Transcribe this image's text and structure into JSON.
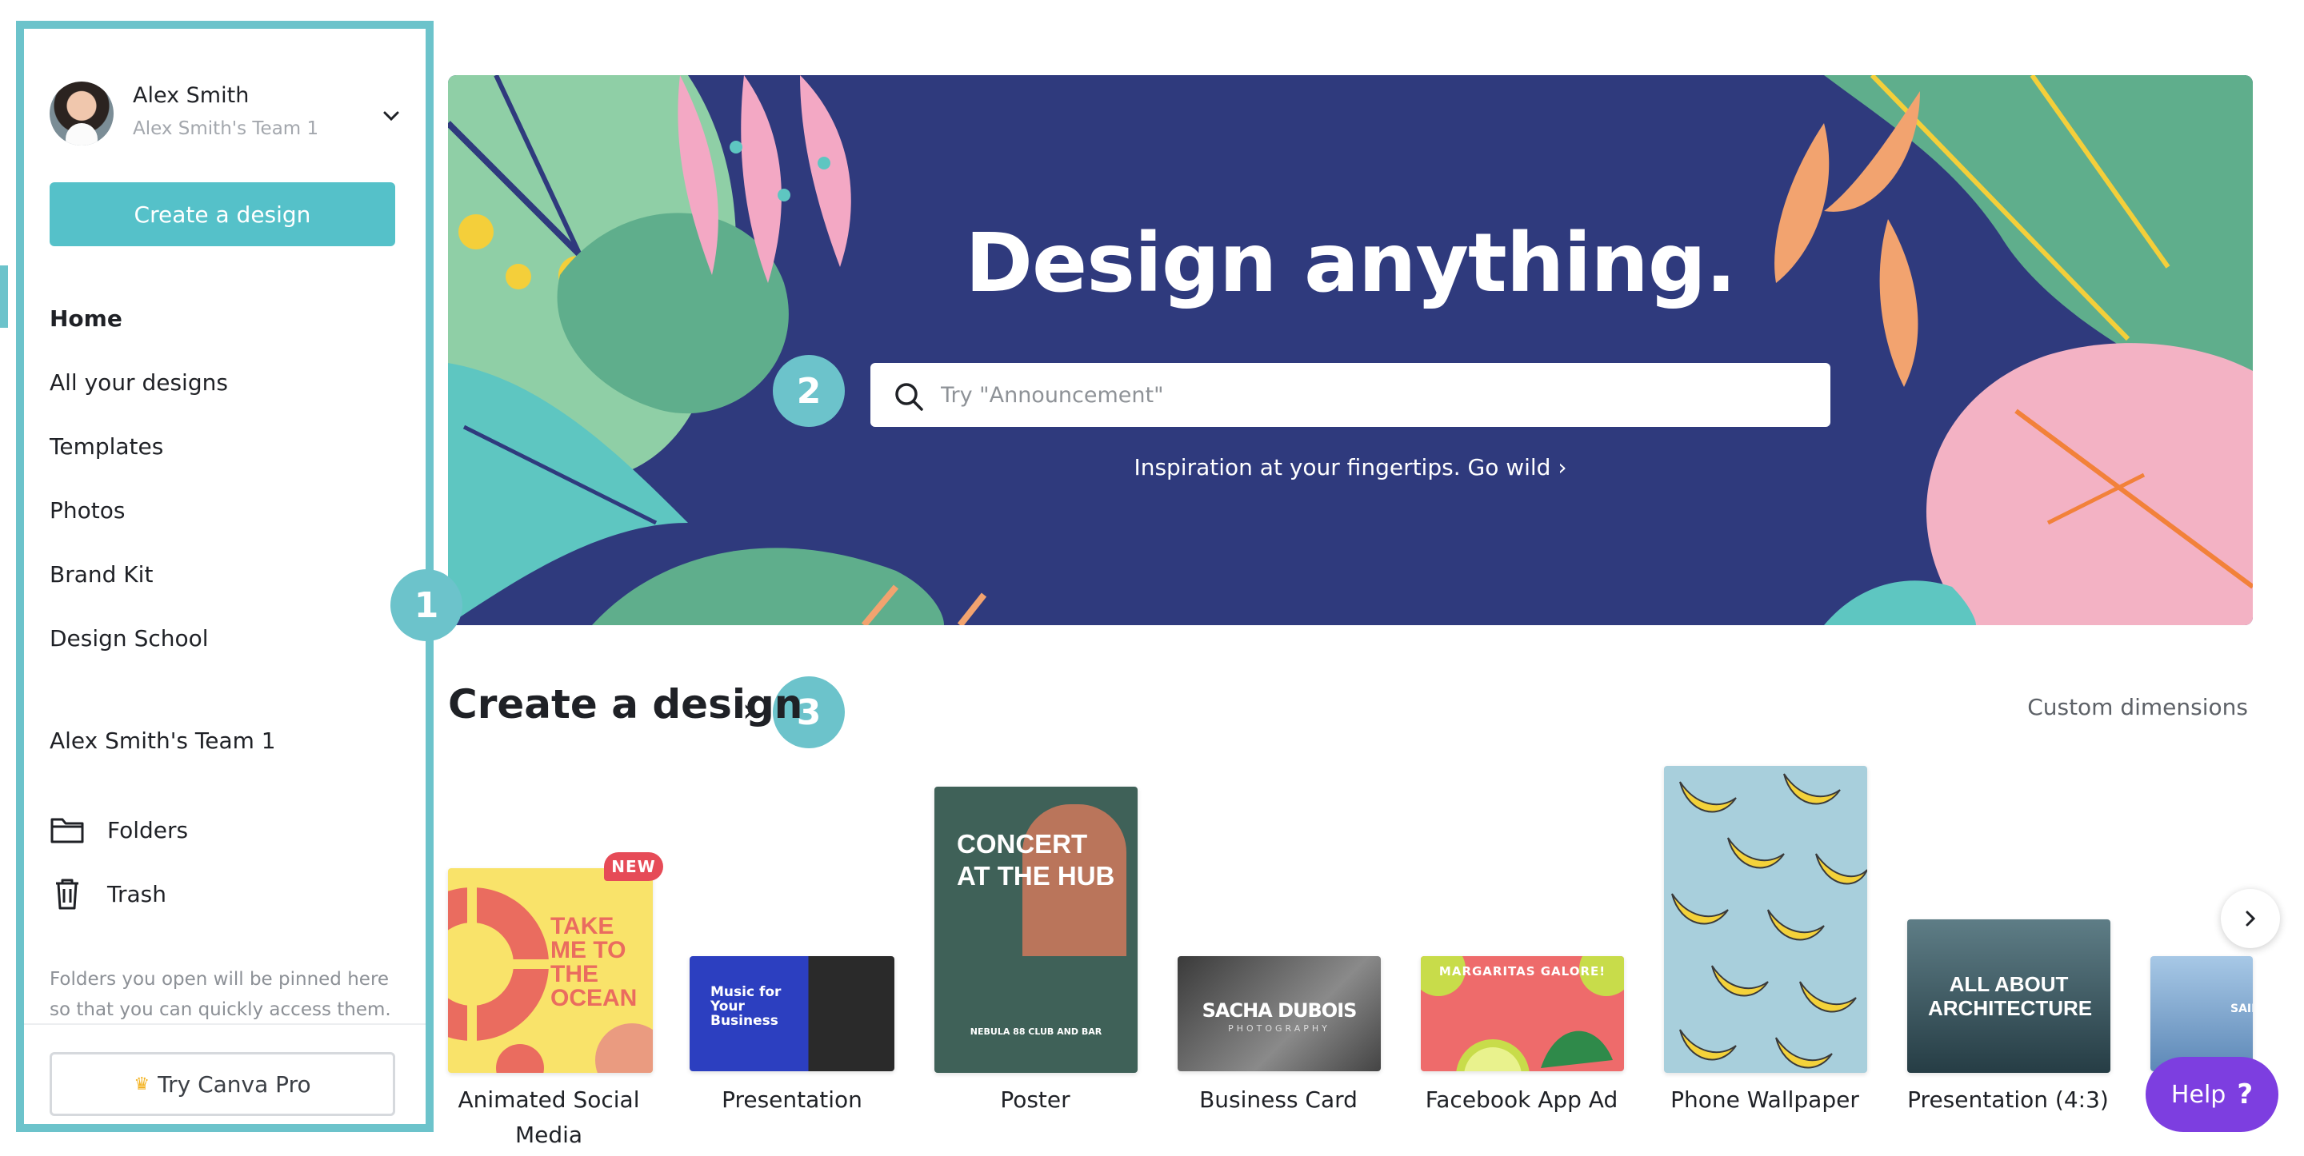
{
  "sidebar": {
    "profile": {
      "name": "Alex Smith",
      "team": "Alex Smith's Team 1"
    },
    "create_label": "Create a design",
    "nav": [
      {
        "label": "Home",
        "active": true
      },
      {
        "label": "All your designs"
      },
      {
        "label": "Templates"
      },
      {
        "label": "Photos"
      },
      {
        "label": "Brand Kit"
      },
      {
        "label": "Design School"
      }
    ],
    "team_label": "Alex Smith's Team 1",
    "folders_label": "Folders",
    "trash_label": "Trash",
    "pin_note": "Folders you open will be pinned here so that you can quickly access them.",
    "pro_label": "Try Canva Pro"
  },
  "badges": [
    "1",
    "2",
    "3"
  ],
  "hero": {
    "title": "Design anything.",
    "search_placeholder": "Try \"Announcement\"",
    "subtitle": "Inspiration at your fingertips. Go wild ›"
  },
  "create_section": {
    "title": "Create a design",
    "arrow": "›",
    "custom_dimensions": "Custom dimensions",
    "new_badge": "NEW",
    "items": [
      {
        "label": "Animated Social Media",
        "thumb_text": "TAKE ME TO THE OCEAN"
      },
      {
        "label": "Presentation",
        "thumb_text": "Music for Your Business"
      },
      {
        "label": "Poster",
        "thumb_text": "CONCERT AT THE HUB",
        "thumb_sub": "NEBULA 88 CLUB AND BAR"
      },
      {
        "label": "Business Card",
        "thumb_text": "SACHA DUBOIS",
        "thumb_sub": "PHOTOGRAPHY"
      },
      {
        "label": "Facebook App Ad",
        "thumb_text": "MARGARITAS GALORE!"
      },
      {
        "label": "Phone Wallpaper"
      },
      {
        "label": "Presentation (4:3)",
        "thumb_text": "ALL ABOUT ARCHITECTURE"
      },
      {
        "label": "",
        "thumb_text": "SAIL"
      }
    ]
  },
  "help": {
    "label": "Help",
    "icon": "?"
  },
  "colors": {
    "accent": "#55c1c9",
    "outline": "#6cc3cb",
    "hero_bg": "#2f3a7d",
    "help": "#7d3ee0"
  }
}
